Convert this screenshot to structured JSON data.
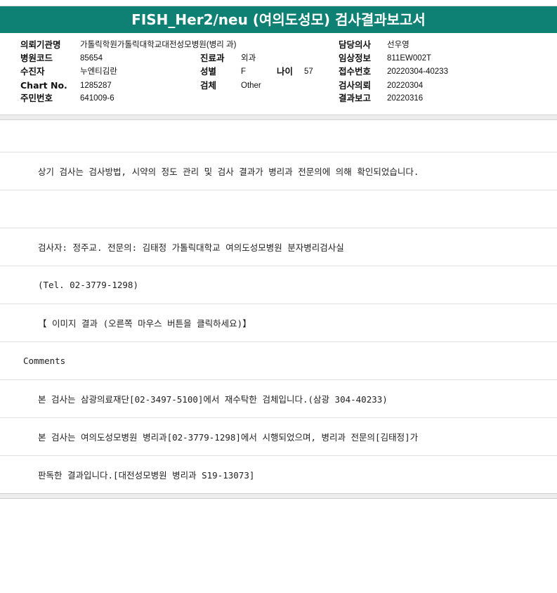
{
  "report": {
    "title": "FISH_Her2/neu (여의도성모) 검사결과보고서"
  },
  "header": {
    "institution_label": "의뢰기관명",
    "institution_value": "가톨릭학원가톨릭대학교대전성모병원(병리 과)",
    "hospital_code_label": "병원코드",
    "hospital_code_value": "85654",
    "patient_label": "수진자",
    "patient_value": "누엔티김란",
    "chart_label": "Chart No.",
    "chart_value": "1285287",
    "id_label": "주민번호",
    "id_value": "641009-6",
    "dept_label": "진료과",
    "dept_value": "외과",
    "sex_label": "성별",
    "sex_value": "F",
    "age_label": "나이",
    "age_value": "57",
    "specimen_label": "검체",
    "specimen_value": "Other",
    "doctor_label": "담당의사",
    "doctor_value": "선우영",
    "clinical_label": "임상정보",
    "clinical_value": "811EW002T",
    "receipt_label": "접수번호",
    "receipt_value": "20220304-40233",
    "request_label": "검사의뢰",
    "request_value": "20220304",
    "result_label": "결과보고",
    "result_value": "20220316"
  },
  "body": {
    "line_confirm": "상기 검사는 검사방법, 시약의 정도 관리 및 검사 결과가 병리과 전문의에 의해 확인되었습니다.",
    "line_examiner": "검사자: 정주교.  전문의: 김태정 가톨릭대학교 여의도성모병원 분자병리검사실",
    "line_tel": "(Tel. 02-3779-1298)",
    "line_image": "【 이미지 결과 (오른쪽 마우스 버튼을 클릭하세요)】",
    "comments_label": "Comments",
    "line_comment1": "본 검사는 삼광의료재단[02-3497-5100]에서 재수탁한 검체입니다.(삼광 304-40233)",
    "line_comment2": "본 검사는 여의도성모병원 병리과[02-3779-1298]에서 시행되었으며, 병리과 전문의[김태정]가",
    "line_comment3": "판독한 결과입니다.[대전성모병원 병리과 S19-13073]"
  },
  "colors": {
    "title_bar": "#0f8174",
    "title_text": "#ffffff"
  }
}
